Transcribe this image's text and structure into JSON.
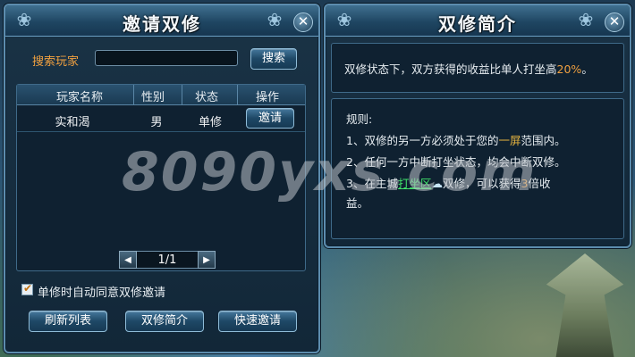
{
  "invite_panel": {
    "title": "邀请双修",
    "search_label": "搜索玩家",
    "search_value": "",
    "search_button": "搜索",
    "columns": [
      "玩家名称",
      "性别",
      "状态",
      "操作"
    ],
    "rows": [
      {
        "name": "实和渴",
        "gender": "男",
        "status": "单修",
        "action": "邀请"
      }
    ],
    "pagination": {
      "page": "1/1",
      "prev": "◀",
      "next": "▶"
    },
    "auto_agree_checked": true,
    "auto_agree_label": "单修时自动同意双修邀请",
    "buttons": {
      "refresh": "刷新列表",
      "intro": "双修简介",
      "quick": "快速邀请"
    }
  },
  "intro_panel": {
    "title": "双修简介",
    "summary_pre": "双修状态下，双方获得的收益比单人打坐高",
    "summary_pct": "20%",
    "summary_post": "。",
    "rules_title": "规则:",
    "rule1_a": "1、双修的另一方必须处于您的",
    "rule1_hl": "一屏",
    "rule1_b": "范围内。",
    "rule2": "2、任何一方中断打坐状态，均会中断双修。",
    "rule3_a": "3、在主城",
    "rule3_link": "打坐区",
    "rule3_b": "双修，可以获得",
    "rule3_num": "3",
    "rule3_c": "倍收",
    "rule3_d": "益。"
  },
  "watermark": "8090yxs.com",
  "colors": {
    "highlight_orange": "#f0a040",
    "link_green": "#3fe06a",
    "gold": "#e0b040"
  }
}
